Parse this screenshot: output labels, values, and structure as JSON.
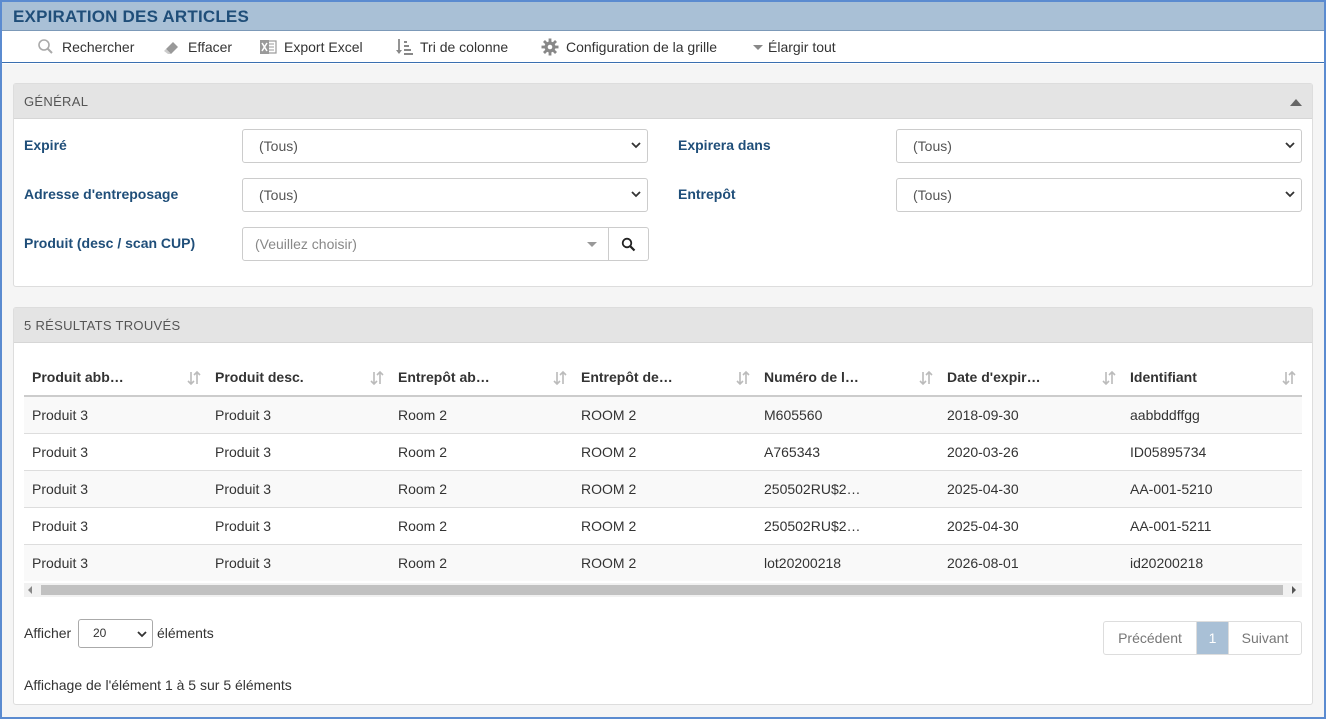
{
  "window": {
    "title": "EXPIRATION DES ARTICLES"
  },
  "toolbar": {
    "search": "Rechercher",
    "clear": "Effacer",
    "export": "Export Excel",
    "sort": "Tri de colonne",
    "grid_config": "Configuration de la grille",
    "expand": "Élargir tout"
  },
  "general": {
    "title": "GÉNÉRAL",
    "expired_label": "Expiré",
    "expired_value": "(Tous)",
    "expires_in_label": "Expirera dans",
    "expires_in_value": "(Tous)",
    "storage_label": "Adresse d'entreposage",
    "storage_value": "(Tous)",
    "warehouse_label": "Entrepôt",
    "warehouse_value": "(Tous)",
    "product_label": "Produit (desc / scan CUP)",
    "product_placeholder": "(Veuillez choisir)"
  },
  "results": {
    "title": "5 RÉSULTATS TROUVÉS",
    "columns": [
      "Produit abb…",
      "Produit desc.",
      "Entrepôt ab…",
      "Entrepôt de…",
      "Numéro de l…",
      "Date d'expir…",
      "Identifiant"
    ],
    "rows": [
      [
        "Produit 3",
        "Produit 3",
        "Room 2",
        "ROOM 2",
        "M605560",
        "2018-09-30",
        "aabbddffgg"
      ],
      [
        "Produit 3",
        "Produit 3",
        "Room 2",
        "ROOM 2",
        "A765343",
        "2020-03-26",
        "ID05895734"
      ],
      [
        "Produit 3",
        "Produit 3",
        "Room 2",
        "ROOM 2",
        "250502RU$2…",
        "2025-04-30",
        "AA-001-5210"
      ],
      [
        "Produit 3",
        "Produit 3",
        "Room 2",
        "ROOM 2",
        "250502RU$2…",
        "2025-04-30",
        "AA-001-5211"
      ],
      [
        "Produit 3",
        "Produit 3",
        "Room 2",
        "ROOM 2",
        "lot20200218",
        "2026-08-01",
        "id20200218"
      ]
    ]
  },
  "footer": {
    "show_label": "Afficher",
    "page_size": "20",
    "items_label": "éléments",
    "prev": "Précédent",
    "current_page": "1",
    "next": "Suivant",
    "info": "Affichage de l'élément 1 à 5 sur 5 éléments"
  },
  "colors": {
    "title_bg": "#a9c0d6",
    "title_text": "#1f4e79",
    "label_text": "#1f4e79",
    "frame_border": "#5b8bd0"
  },
  "icons": {
    "search": "search-icon",
    "clear": "eraser-icon",
    "export": "excel-icon",
    "sort": "sort-icon",
    "config": "gear-icon",
    "expand": "caret-down-icon"
  }
}
